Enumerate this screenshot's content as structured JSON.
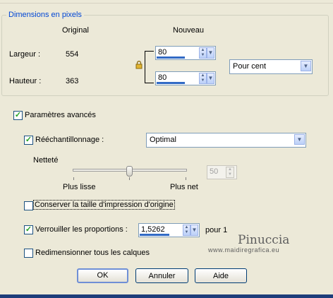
{
  "group": {
    "title": "Dimensions en pixels"
  },
  "columns": {
    "original": "Original",
    "nouveau": "Nouveau"
  },
  "rows": {
    "largeur": {
      "label": "Largeur :",
      "original": "554",
      "value": "80"
    },
    "hauteur": {
      "label": "Hauteur :",
      "original": "363",
      "value": "80"
    }
  },
  "units": {
    "selected": "Pour cent"
  },
  "advanced": {
    "label": "Paramètres avancés",
    "checked": true
  },
  "resample": {
    "label": "Rééchantillonnage :",
    "checked": true,
    "method": "Optimal"
  },
  "sharpness": {
    "label": "Netteté",
    "min_label": "Plus lisse",
    "max_label": "Plus net",
    "value": "50"
  },
  "keep_print_size": {
    "label": "Conserver la taille d'impression d'origine",
    "checked": false
  },
  "lock_ratio": {
    "label": "Verrouiller les proportions :",
    "checked": true,
    "value": "1,5262",
    "suffix": "pour 1"
  },
  "resize_layers": {
    "label": "Redimensionner tous les calques",
    "checked": false
  },
  "buttons": {
    "ok": "OK",
    "cancel": "Annuler",
    "help": "Aide"
  },
  "watermark": {
    "name": "Pinuccia",
    "url": "www.maidiregrafica.eu"
  },
  "colors": {
    "accent": "#316ac5",
    "legend": "#0046d5",
    "check": "#21a121"
  },
  "icons": {
    "lock": "lock-icon",
    "spin": "spin-updown-icon",
    "dropdown": "chevron-down-icon"
  }
}
